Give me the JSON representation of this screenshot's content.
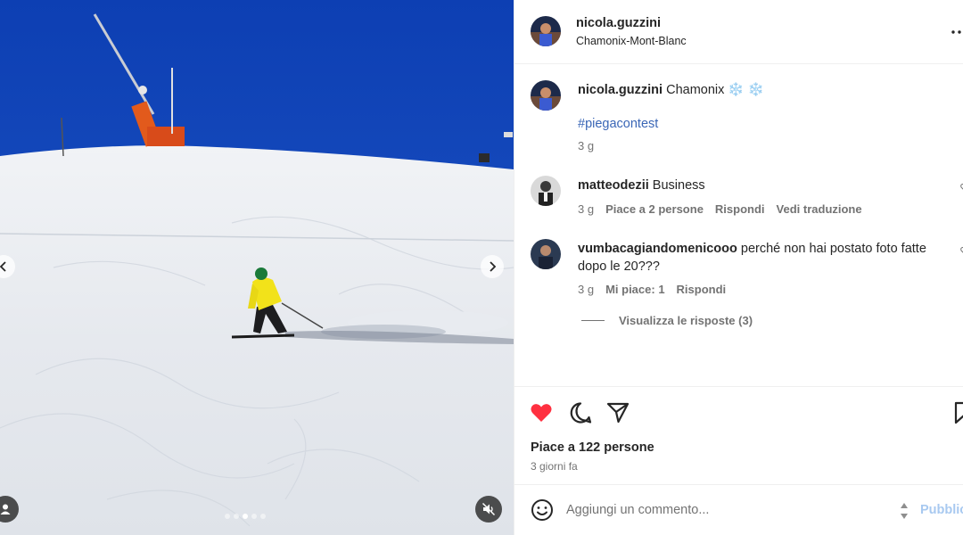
{
  "post": {
    "username": "nicola.guzzini",
    "location": "Chamonix-Mont-Blanc"
  },
  "caption": {
    "username": "nicola.guzzini",
    "text": "Chamonix ❄️ ❄️",
    "hashtag": "#piegacontest",
    "time": "3 g"
  },
  "comments": [
    {
      "username": "matteodezii",
      "text": "Business",
      "time": "3 g",
      "likes": "Piace a 2 persone",
      "reply": "Rispondi",
      "translate": "Vedi traduzione"
    },
    {
      "username": "vumbacagiandomenicooo",
      "text": "perché non hai postato foto fatte dopo le 20???",
      "time": "3 g",
      "likes": "Mi piace: 1",
      "reply": "Rispondi"
    }
  ],
  "view_replies": "Visualizza le risposte (3)",
  "likes_summary": "Piace a 122 persone",
  "posted_ago": "3 giorni fa",
  "comment_box": {
    "placeholder": "Aggiungi un commento...",
    "publish": "Pubblica"
  },
  "carousel": {
    "total": 5,
    "active": 3
  },
  "colors": {
    "like": "#ff3040",
    "link": "#3a66b6",
    "sky": "#1a4ec2",
    "jacket": "#f2e21a"
  },
  "icons": [
    "more-icon",
    "heart-icon",
    "comment-icon",
    "share-icon",
    "bookmark-icon",
    "emoji-icon",
    "chevron-left-icon",
    "chevron-right-icon",
    "user-tag-icon",
    "mute-icon"
  ]
}
